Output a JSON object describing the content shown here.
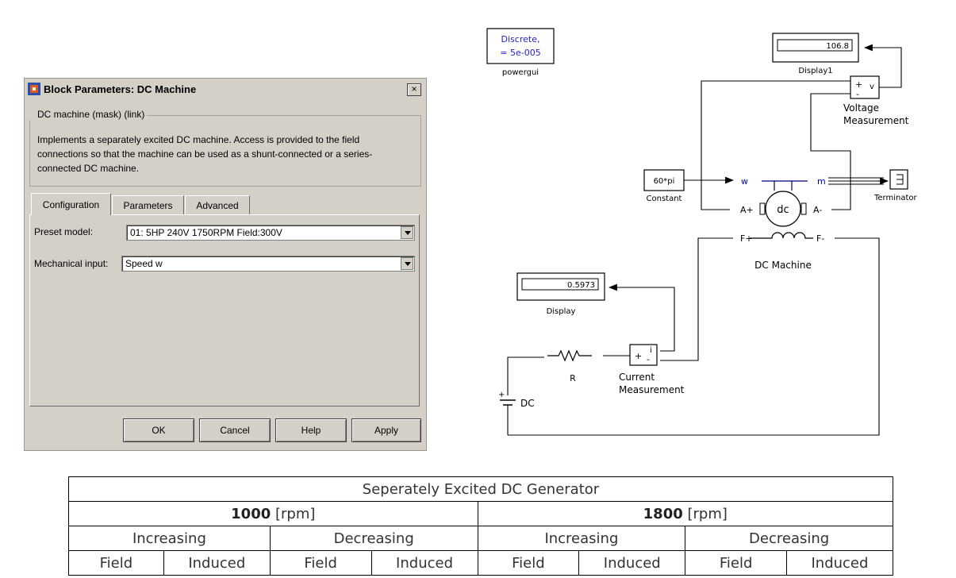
{
  "dialog": {
    "title": "Block Parameters: DC Machine",
    "close_label": "×",
    "group_title": "DC machine (mask) (link)",
    "description": "Implements a separately excited DC machine. Access is provided  to the field connections so that the machine can be used as a shunt-connected or a series-connected  DC machine.",
    "tabs": [
      {
        "label": "Configuration",
        "active": true
      },
      {
        "label": "Parameters",
        "active": false
      },
      {
        "label": "Advanced",
        "active": false
      }
    ],
    "preset_model": {
      "label": "Preset  model:",
      "value": "01: 5HP 240V 1750RPM Field:300V"
    },
    "mechanical_input": {
      "label": "Mechanical input:",
      "value": "Speed w"
    },
    "buttons": {
      "ok": "OK",
      "cancel": "Cancel",
      "help": "Help",
      "apply": "Apply"
    }
  },
  "diagram": {
    "powergui": {
      "line1": "Discrete,",
      "line2": "= 5e-005",
      "label": "powergui"
    },
    "display1": {
      "value": "106.8",
      "label": "Display1"
    },
    "voltage_measurement": {
      "plus": "+",
      "minus": "-",
      "port": "v",
      "label1": "Voltage",
      "label2": "Measurement"
    },
    "constant": {
      "value": "60*pi",
      "label": "Constant"
    },
    "terminator": {
      "label": "Terminator"
    },
    "dc_machine": {
      "w": "w",
      "m": "m",
      "a_plus": "A+",
      "a_minus": "A-",
      "f_plus": "F+",
      "f_minus": "F-",
      "core": "dc",
      "label": "DC Machine"
    },
    "display": {
      "value": "0.5973",
      "label": "Display"
    },
    "resistor": {
      "label": "R"
    },
    "current_measurement": {
      "plus": "+",
      "minus": "-",
      "port": "i",
      "label1": "Current",
      "label2": "Measurement"
    },
    "dc_source": {
      "label": "DC",
      "plus": "+"
    },
    "colors": {
      "port_label": "#0000cc",
      "wire": "#000000"
    }
  },
  "table": {
    "title": "Seperately Excited DC Generator",
    "speeds": [
      {
        "value": "1000",
        "unit": "[rpm]"
      },
      {
        "value": "1800",
        "unit": "[rpm]"
      }
    ],
    "directions": [
      "Increasing",
      "Decreasing",
      "Increasing",
      "Decreasing"
    ],
    "columns": [
      "Field",
      "Induced",
      "Field",
      "Induced",
      "Field",
      "Induced",
      "Field",
      "Induced"
    ]
  }
}
